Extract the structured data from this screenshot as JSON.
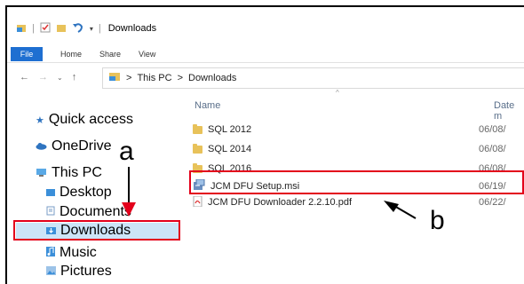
{
  "window": {
    "title": "Downloads"
  },
  "ribbon": {
    "tabs": [
      "File",
      "Home",
      "Share",
      "View"
    ]
  },
  "address": {
    "segments": [
      "This PC",
      "Downloads"
    ],
    "separator": ">"
  },
  "nav_pane": {
    "items": [
      {
        "label": "Quick access"
      },
      {
        "label": "OneDrive"
      },
      {
        "label": "This PC"
      },
      {
        "label": "Desktop"
      },
      {
        "label": "Documents"
      },
      {
        "label": "Downloads"
      },
      {
        "label": "Music"
      },
      {
        "label": "Pictures"
      }
    ]
  },
  "file_list": {
    "columns": {
      "name": "Name",
      "date": "Date m"
    },
    "rows": [
      {
        "name": "SQL 2012",
        "date": "06/08/"
      },
      {
        "name": "SQL 2014",
        "date": "06/08/"
      },
      {
        "name": "SQL 2016",
        "date": "06/08/"
      },
      {
        "name": "JCM DFU Setup.msi",
        "date": "06/19/"
      },
      {
        "name": "JCM DFU Downloader 2.2.10.pdf",
        "date": "06/22/"
      }
    ]
  },
  "annotations": {
    "a": "a",
    "b": "b"
  },
  "colors": {
    "accent": "#1e6fd1",
    "highlight": "#e3001b",
    "selected": "#cce4f7"
  }
}
